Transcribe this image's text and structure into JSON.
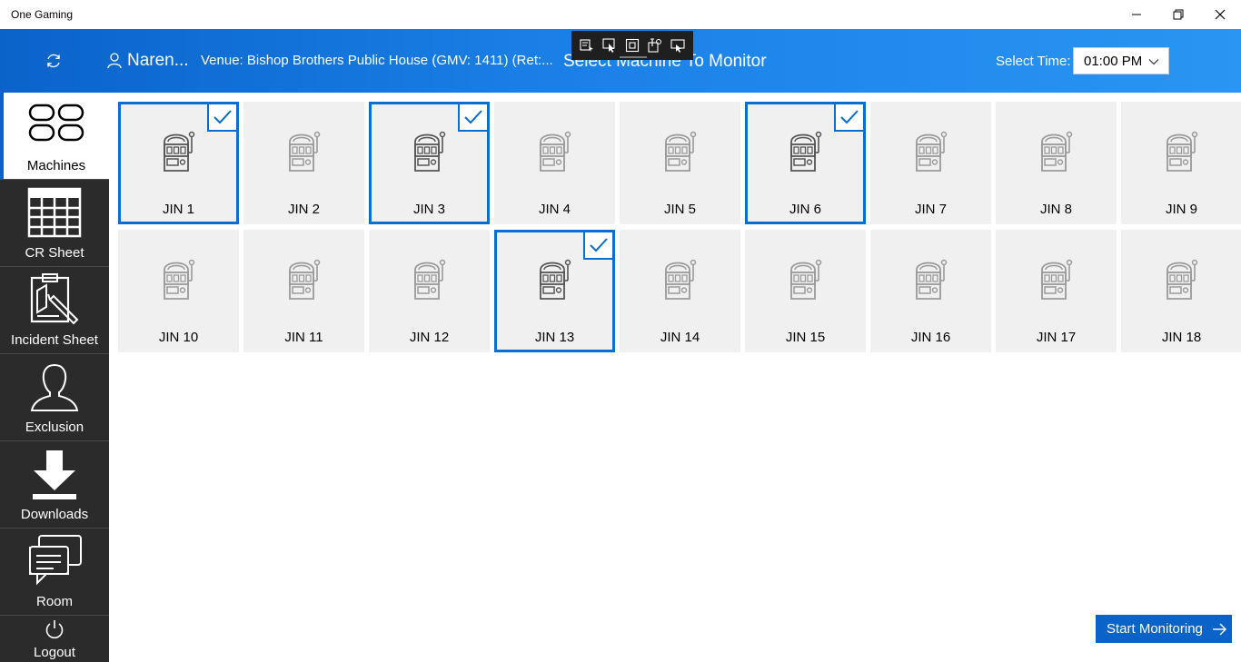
{
  "window": {
    "title": "One Gaming",
    "controls": [
      "minimize-icon",
      "restore-icon",
      "close-icon"
    ]
  },
  "header": {
    "user_name": "Naren...",
    "venue": "Venue: Bishop Brothers Public House (GMV: 1411) (Ret:...",
    "page_title": "Select Machine To Monitor",
    "select_time_label": "Select Time:",
    "select_time_value": "01:00 PM"
  },
  "sidebar": {
    "items": [
      {
        "label": "Machines",
        "icon": "machines-icon",
        "active": true
      },
      {
        "label": "CR Sheet",
        "icon": "grid-sheet-icon",
        "active": false
      },
      {
        "label": "Incident Sheet",
        "icon": "clipboard-pen-icon",
        "active": false
      },
      {
        "label": "Exclusion",
        "icon": "person-icon",
        "active": false
      },
      {
        "label": "Downloads",
        "icon": "download-icon",
        "active": false
      },
      {
        "label": "Room",
        "icon": "chat-bubbles-icon",
        "active": false
      }
    ],
    "logout_label": "Logout"
  },
  "machines": [
    {
      "label": "JIN 1",
      "selected": true
    },
    {
      "label": "JIN 2",
      "selected": false
    },
    {
      "label": "JIN 3",
      "selected": true
    },
    {
      "label": "JIN 4",
      "selected": false
    },
    {
      "label": "JIN 5",
      "selected": false
    },
    {
      "label": "JIN 6",
      "selected": true
    },
    {
      "label": "JIN 7",
      "selected": false
    },
    {
      "label": "JIN 8",
      "selected": false
    },
    {
      "label": "JIN 9",
      "selected": false
    },
    {
      "label": "JIN 10",
      "selected": false
    },
    {
      "label": "JIN 11",
      "selected": false
    },
    {
      "label": "JIN 12",
      "selected": false
    },
    {
      "label": "JIN 13",
      "selected": true
    },
    {
      "label": "JIN 14",
      "selected": false
    },
    {
      "label": "JIN 15",
      "selected": false
    },
    {
      "label": "JIN 16",
      "selected": false
    },
    {
      "label": "JIN 17",
      "selected": false
    },
    {
      "label": "JIN 18",
      "selected": false
    }
  ],
  "actions": {
    "start_monitoring": "Start Monitoring"
  },
  "colors": {
    "accent": "#0a63c9",
    "selection_border": "#0a6ed1",
    "sidebar_bg": "#2b2b2b",
    "tile_bg": "#f0f0f0"
  }
}
